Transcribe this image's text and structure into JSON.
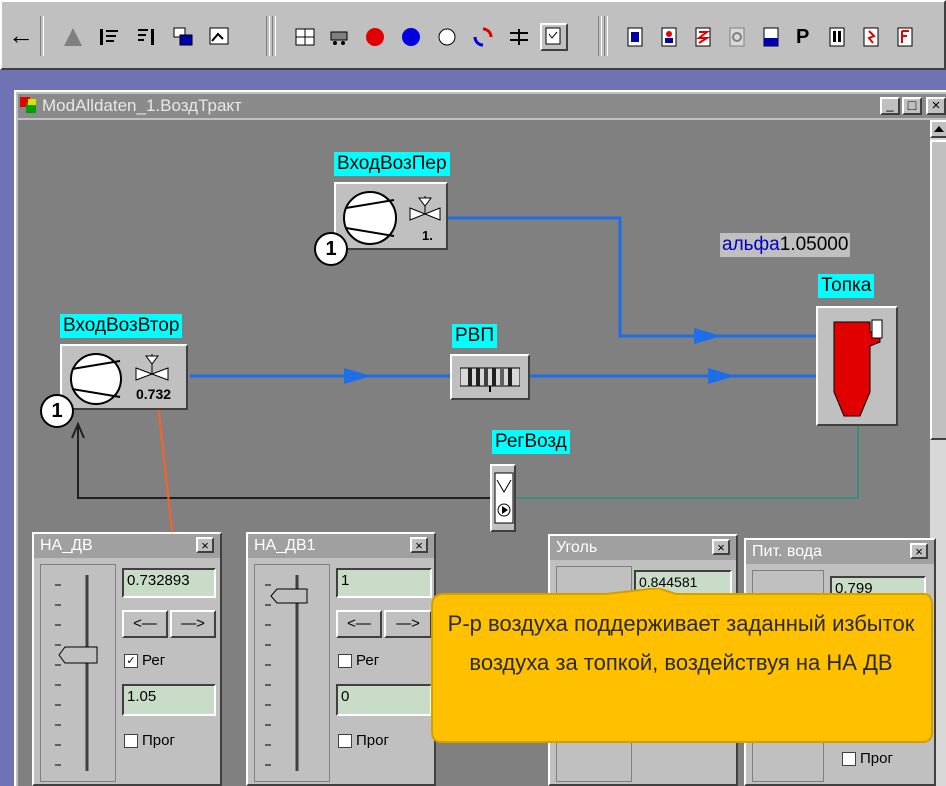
{
  "window": {
    "title": "ModAlldaten_1.ВоздТракт",
    "min": "_",
    "max": "□",
    "close": "×"
  },
  "nodes": {
    "vhod_vos_per": {
      "label": "ВходВозПер",
      "value": "1.",
      "badge": "1"
    },
    "vhod_vos_vtor": {
      "label": "ВходВозВтор",
      "value": "0.732",
      "badge": "1"
    },
    "rvp": {
      "label": "РВП"
    },
    "reg_vozd": {
      "label": "РегВозд"
    },
    "topka": {
      "label": "Топка"
    },
    "alpha": {
      "label": "альфа",
      "value": "1.05000"
    }
  },
  "panels": {
    "na_dv": {
      "title": "НА_ДВ",
      "value": "0.732893",
      "left": "<—",
      "right": "—>",
      "reg_label": "Рег",
      "reg_checked": "✓",
      "setpoint": "1.05",
      "prog_label": "Прог",
      "close": "×"
    },
    "na_dv1": {
      "title": "НА_ДВ1",
      "value": "1",
      "left": "<—",
      "right": "—>",
      "reg_label": "Рег",
      "setpoint": "0",
      "prog_label": "Прог",
      "close": "×"
    },
    "ugol": {
      "title": "Уголь",
      "value": "0.844581",
      "close": "×"
    },
    "pit_voda": {
      "title": "Пит. вода",
      "value": "0.799",
      "prog_label": "Прог",
      "close": "×"
    }
  },
  "tooltip": {
    "text": "Р-р воздуха поддерживает заданный избыток воздуха за топкой, воздействуя на НА ДВ"
  },
  "toolbar": {
    "p_label": "P"
  },
  "colors": {
    "canvas": "#808080",
    "pipe_blue": "#1e6ee8",
    "pipe_teal": "#3c8c80",
    "label_bg": "#00ffff",
    "tooltip_bg": "#ffc000",
    "tooltip_border": "#d4a000"
  }
}
